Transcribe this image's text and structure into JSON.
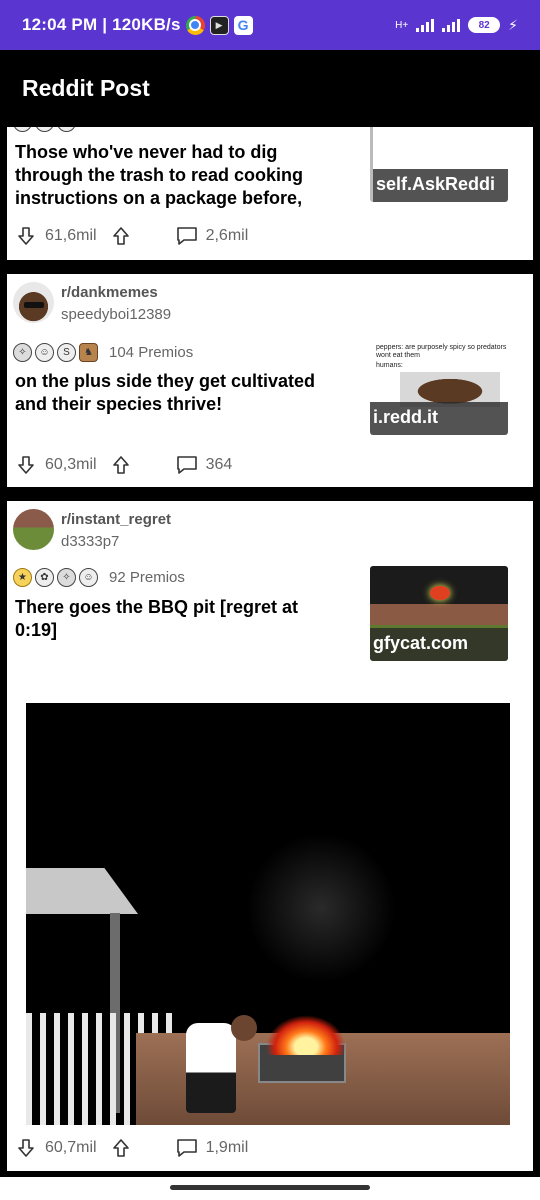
{
  "status_bar": {
    "time": "12:04 PM",
    "speed": "120KB/s",
    "network": "H+",
    "battery": "82",
    "icons": [
      "chrome-icon",
      "play-icon",
      "google-icon",
      "signal-icon",
      "signal-icon",
      "battery-icon",
      "charging-icon"
    ]
  },
  "app_bar": {
    "title": "Reddit Post"
  },
  "posts": [
    {
      "title": "Those who've never had to dig through the trash to read cooking instructions on a package before,",
      "domain": "self.AskReddi",
      "downvote_count": "61,6mil",
      "comments": "2,6mil"
    },
    {
      "subreddit": "r/dankmemes",
      "user": "speedyboi12389",
      "awards": "104 Premios",
      "title": "on the plus side they get cultivated and their species thrive!",
      "domain": "i.redd.it",
      "thumb_top": "peppers: are purposely spicy so predators wont eat them",
      "thumb_mid": "humans:",
      "downvote_count": "60,3mil",
      "comments": "364"
    },
    {
      "subreddit": "r/instant_regret",
      "user": "d3333p7",
      "awards": "92 Premios",
      "title": "There goes the BBQ pit [regret at 0:19]",
      "domain": "gfycat.com",
      "downvote_count": "60,7mil",
      "comments": "1,9mil"
    }
  ],
  "colors": {
    "status_bar": "#5b35cf",
    "app_bar": "#000000",
    "card": "#ffffff"
  }
}
